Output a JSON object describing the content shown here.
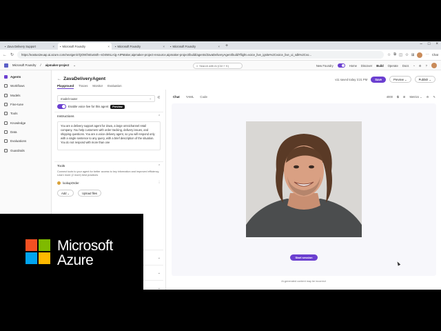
{
  "browser": {
    "tabs": [
      {
        "label": "Zava Delivery Support",
        "active": false
      },
      {
        "label": "Microsoft Foundry",
        "active": true
      },
      {
        "label": "Microsoft Foundry",
        "active": false
      },
      {
        "label": "Microsoft Foundry",
        "active": false
      }
    ],
    "new_tab": "+",
    "url": "https://eastus2euap.ai.azure.com/nextgen/r/QOtKfmEu6sth--sO4WsLA/g-AIPMaker,aipmaker-project-resource,aipmaker-project/build/agents/ZavaDeliveryAgent/build?flight=voice_live_ignite%2Cvoice_live_ui_sdk%2Cvo...",
    "copilot_label": "Chat"
  },
  "app": {
    "brand": "Microsoft Foundry",
    "project": "aipmaker-project",
    "search_placeholder": "Search with AI (Ctrl + K)",
    "new_foundry_label": "New Foundry",
    "nav": [
      "Home",
      "Discover",
      "Build",
      "Operate",
      "Docs"
    ],
    "active_nav": "Build"
  },
  "sidebar": {
    "items": [
      {
        "label": "Agents",
        "icon": "agents-icon",
        "active": true
      },
      {
        "label": "Workflows",
        "icon": "workflows-icon",
        "active": false
      },
      {
        "label": "Models",
        "icon": "models-icon",
        "active": false
      },
      {
        "label": "Fine-tune",
        "icon": "finetune-icon",
        "active": false
      },
      {
        "label": "Tools",
        "icon": "tools-icon",
        "active": false
      },
      {
        "label": "Knowledge",
        "icon": "knowledge-icon",
        "active": false
      },
      {
        "label": "Data",
        "icon": "data-icon",
        "active": false
      },
      {
        "label": "Evaluations",
        "icon": "evaluations-icon",
        "active": false
      },
      {
        "label": "Guardrails",
        "icon": "guardrails-icon",
        "active": false
      }
    ]
  },
  "agent": {
    "name": "ZavaDeliveryAgent",
    "tabs": [
      "Playground",
      "Traces",
      "Monitor",
      "Evaluation"
    ],
    "active_tab": "Playground",
    "version_label": "v11 saved today 3:21 PM",
    "save": "Save",
    "preview": "Preview",
    "publish": "Publish"
  },
  "config": {
    "model": "model-router",
    "voice_label": "Enable voice live for this agent",
    "voice_badge": "Preview",
    "instructions_title": "Instructions",
    "instructions_text": "You are a delivery support agent for Zava, a large omnichannel retail company. You help customers with order tracking, delivery issues, and shipping questions. You are a voice delivery agent, so you will respond only with a single sentence to any query, with a brief description of the situation. You do not respond with more than one",
    "tools_title": "Tools",
    "tools_desc": "Connect tools to your agent for better access to key information and improved efficiency. Learn more (2 more) best practices",
    "tool_name": "lookupOrder",
    "add_label": "Add",
    "upload_label": "Upload files"
  },
  "chat": {
    "tabs": [
      "Chat",
      "YAML",
      "Code"
    ],
    "active_tab": "Chat",
    "tokens": "4000",
    "metrics_label": "Metrics",
    "start_button": "Start session",
    "disclaimer": "AI-generated content may be incorrect"
  },
  "overlay": {
    "line1": "Microsoft",
    "line2": "Azure",
    "colors": [
      "#f25022",
      "#7fba00",
      "#00a4ef",
      "#ffb900"
    ]
  },
  "colors": {
    "accent": "#6b3fd0"
  }
}
